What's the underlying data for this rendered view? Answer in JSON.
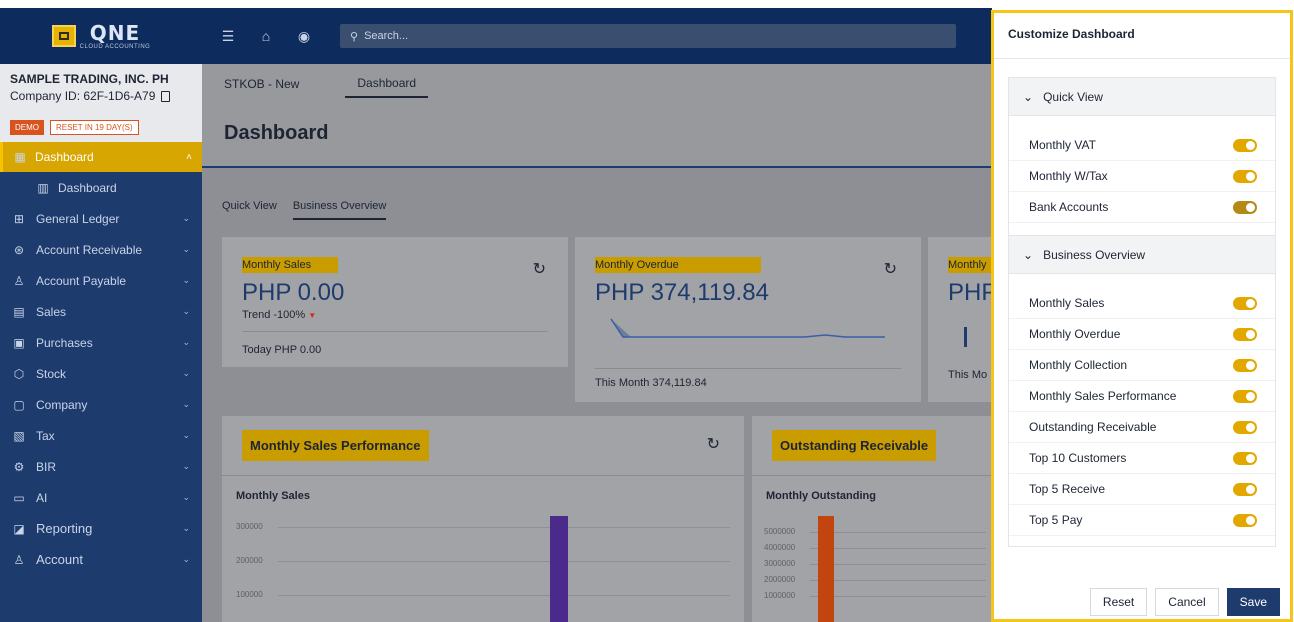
{
  "logo": {
    "name": "QNE",
    "tagline": "CLOUD ACCOUNTING"
  },
  "company": {
    "name": "SAMPLE TRADING, INC. PH",
    "id": "Company ID: 62F-1D6-A79",
    "badge_demo": "DEMO",
    "badge_reset": "RESET IN 19 DAY(S)"
  },
  "sidebar": {
    "active": "Dashboard",
    "sub": "Dashboard",
    "items": [
      {
        "label": "General Ledger",
        "icon": "ledger-icon"
      },
      {
        "label": "Account Receivable",
        "icon": "receivable-icon"
      },
      {
        "label": "Account Payable",
        "icon": "payable-icon"
      },
      {
        "label": "Sales",
        "icon": "sales-icon"
      },
      {
        "label": "Purchases",
        "icon": "purchases-icon"
      },
      {
        "label": "Stock",
        "icon": "stock-icon"
      },
      {
        "label": "Company",
        "icon": "company-icon"
      },
      {
        "label": "Tax",
        "icon": "tax-icon"
      },
      {
        "label": "BIR",
        "icon": "bir-icon"
      },
      {
        "label": "AI",
        "icon": "ai-icon"
      },
      {
        "label": "Reporting",
        "icon": "reporting-icon"
      },
      {
        "label": "Account",
        "icon": "user-icon"
      }
    ]
  },
  "topbar": {
    "search_placeholder": "Search..."
  },
  "main": {
    "tabs": [
      "STKOB - New",
      "Dashboard"
    ],
    "title": "Dashboard",
    "subtabs": [
      "Quick View",
      "Business Overview"
    ],
    "card1": {
      "title": "Monthly Sales",
      "value": "PHP 0.00",
      "trend": "Trend -100%",
      "footer": "Today PHP 0.00"
    },
    "card2": {
      "title": "Monthly Overdue",
      "value": "PHP 374,119.84",
      "footer": "This Month 374,119.84"
    },
    "card3": {
      "title": "Monthly",
      "value": "PHP",
      "footer": "This Mo"
    },
    "perf": {
      "title": "Monthly Sales Performance",
      "subtitle": "Monthly Sales",
      "ticks": [
        "300000",
        "200000",
        "100000"
      ]
    },
    "outstanding": {
      "title": "Outstanding Receivable",
      "subtitle": "Monthly Outstanding",
      "ticks": [
        "5000000",
        "4000000",
        "3000000",
        "2000000",
        "1000000"
      ]
    }
  },
  "panel": {
    "title": "Customize Dashboard",
    "quick_view": {
      "title": "Quick View",
      "items": [
        "Monthly VAT",
        "Monthly W/Tax",
        "Bank Accounts"
      ]
    },
    "business_overview": {
      "title": "Business Overview",
      "items": [
        "Monthly Sales",
        "Monthly Overdue",
        "Monthly Collection",
        "Monthly Sales Performance",
        "Outstanding Receivable",
        "Top 10 Customers",
        "Top 5 Receive",
        "Top 5 Pay"
      ]
    },
    "buttons": {
      "reset": "Reset",
      "cancel": "Cancel",
      "save": "Save"
    }
  },
  "colors": {
    "accent": "#e3a800",
    "navy": "#1e3b6e",
    "highlight": "#f5c518"
  }
}
